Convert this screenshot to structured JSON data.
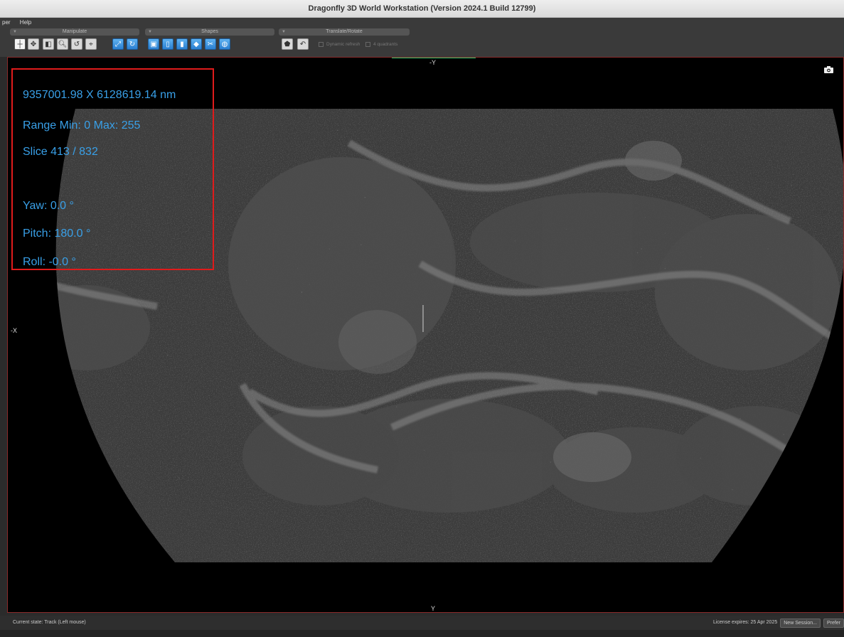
{
  "window": {
    "title": "Dragonfly 3D World Workstation (Version 2024.1 Build 12799)"
  },
  "menu": {
    "items": [
      "per",
      "Help"
    ]
  },
  "toolbar": {
    "groups": {
      "manipulate": "Manipulate",
      "shapes": "Shapes",
      "translate": "Translate/Rotate"
    },
    "dynamic_refresh": "Dynamic refresh",
    "quadrants": "4 quadrants"
  },
  "viewport": {
    "axis_top": "-Y",
    "axis_bottom": "Y",
    "axis_left": "-X",
    "overlay": {
      "dimensions": "9357001.98 X 6128619.14 nm",
      "range": "Range Min: 0 Max: 255",
      "slice": "Slice 413 / 832",
      "yaw": "Yaw: 0.0 °",
      "pitch": "Pitch: 180.0 °",
      "roll": "Roll: -0.0 °"
    }
  },
  "status": {
    "current_state": "Current state: Track (Left mouse)",
    "license": "License expires:  25 Apr 2025",
    "new_session": "New Session...",
    "preferences": "Prefer"
  },
  "colors": {
    "overlay_text": "#39a0e8",
    "overlay_border": "#e01b1b",
    "active_indicator": "#2ecc71"
  }
}
